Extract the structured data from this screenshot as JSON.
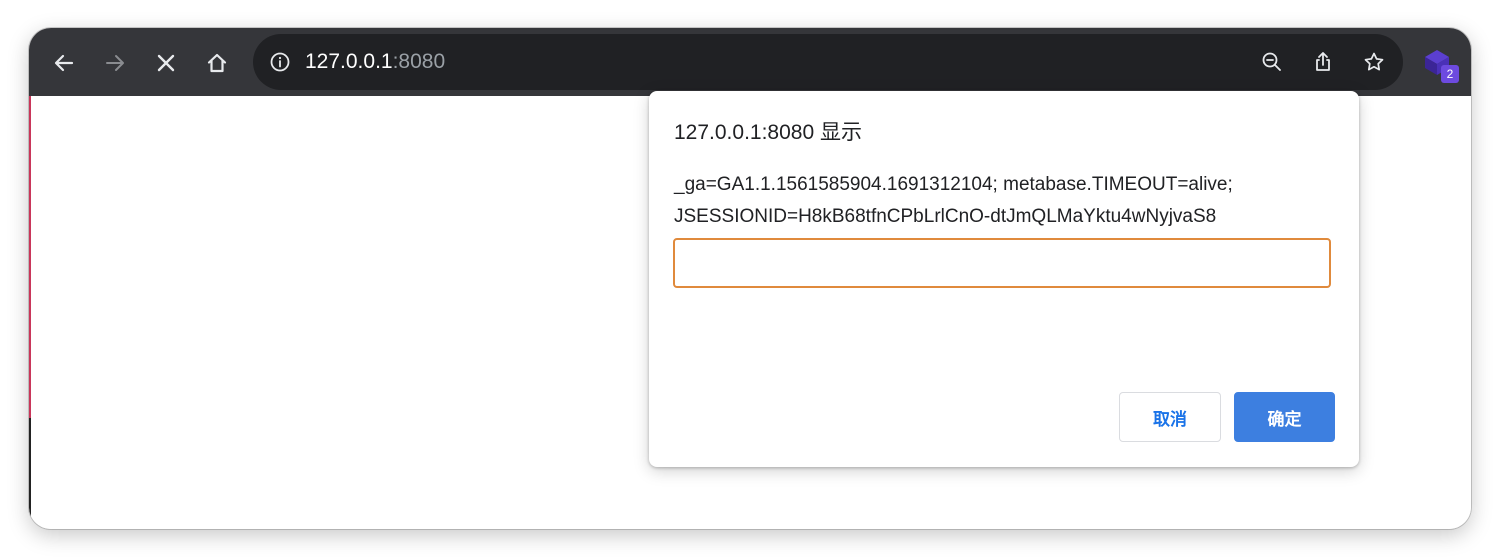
{
  "browser": {
    "address_bar": {
      "host": "127.0.0.1",
      "port": ":8080"
    },
    "icons": {
      "back": "arrow-left-icon",
      "forward": "arrow-right-icon",
      "stop": "close-icon",
      "home": "home-icon",
      "site_info": "info-icon",
      "zoom": "zoom-out-icon",
      "share": "share-icon",
      "bookmark": "star-icon",
      "extension": "extension-icon"
    },
    "extension_badge": "2"
  },
  "dialog": {
    "title": "127.0.0.1:8080 显示",
    "message_lines": [
      "_ga=GA1.1.1561585904.1691312104; metabase.TIMEOUT=alive;",
      "JSESSIONID=H8kB68tfnCPbLrlCnO-dtJmQLMaYktu4wNyjvaS8"
    ],
    "input_value": "",
    "cancel_label": "取消",
    "ok_label": "确定"
  },
  "colors": {
    "toolbar": "#35363a",
    "omnibox": "#202124",
    "primary_button": "#3d7fe0",
    "input_focus_border": "#e08a3c",
    "extension_badge": "#6d4adf"
  }
}
